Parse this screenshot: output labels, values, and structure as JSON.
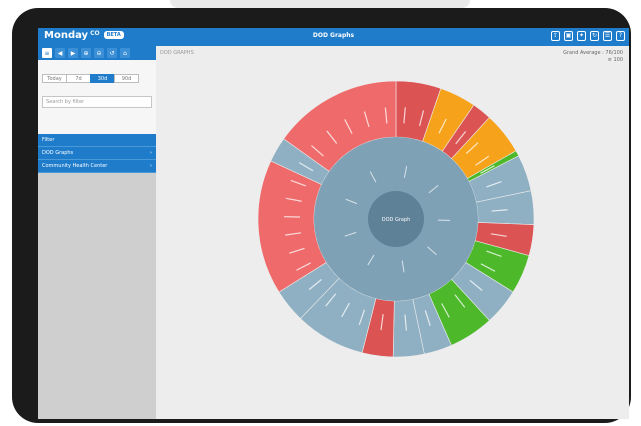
{
  "app": {
    "brand": "Monday",
    "brand_sup": "CO",
    "brand_badge": "BETA",
    "title": "DOD Graphs"
  },
  "topbar_icons": [
    {
      "icon": "export-icon",
      "glyph": "⇪"
    },
    {
      "icon": "save-icon",
      "glyph": "▣"
    },
    {
      "icon": "pin-icon",
      "glyph": "✦"
    },
    {
      "icon": "refresh-icon",
      "glyph": "↻"
    },
    {
      "icon": "list-icon",
      "glyph": "☰"
    },
    {
      "icon": "help-icon",
      "glyph": "?"
    }
  ],
  "sidebar": {
    "tools": [
      {
        "label": "≡",
        "active": true
      },
      {
        "label": "◀",
        "active": false
      },
      {
        "label": "▶",
        "active": false
      },
      {
        "label": "⊕",
        "active": false
      },
      {
        "label": "⊖",
        "active": false
      },
      {
        "label": "↺",
        "active": false
      },
      {
        "label": "⌂",
        "active": false
      }
    ],
    "segments": [
      {
        "label": "Today",
        "active": false
      },
      {
        "label": "7d",
        "active": false
      },
      {
        "label": "30d",
        "active": true
      },
      {
        "label": "90d",
        "active": false
      }
    ],
    "search_placeholder": "Search by filter",
    "nav": [
      {
        "label": "Filter",
        "chevron": ""
      },
      {
        "label": "DOD Graphs",
        "chevron": "›"
      },
      {
        "label": "Community Health Center",
        "chevron": "›"
      }
    ]
  },
  "main": {
    "breadcrumb": "DOD GRAPHS",
    "info_line1": "Grand Average : 76/100",
    "info_line2": "≡ 100"
  },
  "colors": {
    "blue": "#1f7ccb",
    "red": "#ef6b6b",
    "darkred": "#dc5353",
    "orange": "#f7a21b",
    "green": "#4cb82a",
    "steel": "#8fb0c3",
    "steel_inner": "#7ea1b6",
    "steel_center": "#5e8197"
  },
  "chart_data": {
    "type": "sunburst",
    "center_label": "DOD Graph",
    "middle_ring": {
      "values": [
        1
      ],
      "color": "steel"
    },
    "outer_ring": [
      {
        "value": 32,
        "color": "darkred"
      },
      {
        "value": 26,
        "color": "orange"
      },
      {
        "value": 14,
        "color": "darkred"
      },
      {
        "value": 30,
        "color": "orange"
      },
      {
        "value": 4,
        "color": "green"
      },
      {
        "value": 26,
        "color": "steel"
      },
      {
        "value": 24,
        "color": "steel"
      },
      {
        "value": 22,
        "color": "darkred"
      },
      {
        "value": 28,
        "color": "green"
      },
      {
        "value": 26,
        "color": "steel"
      },
      {
        "value": 32,
        "color": "green"
      },
      {
        "value": 20,
        "color": "steel"
      },
      {
        "value": 22,
        "color": "steel"
      },
      {
        "value": 22,
        "color": "darkred"
      },
      {
        "value": 50,
        "color": "steel"
      },
      {
        "value": 24,
        "color": "steel"
      },
      {
        "value": 96,
        "color": "red"
      },
      {
        "value": 18,
        "color": "steel"
      },
      {
        "value": 92,
        "color": "red"
      }
    ]
  }
}
